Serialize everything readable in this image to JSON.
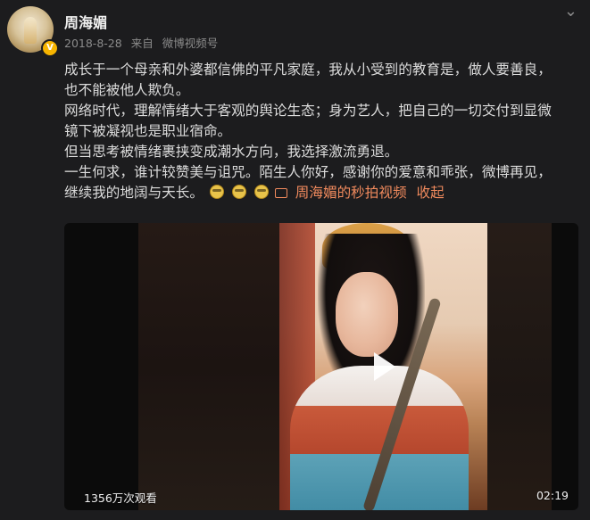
{
  "post": {
    "user": {
      "name": "周海媚",
      "verified_badge": "V"
    },
    "meta": {
      "date": "2018-8-28",
      "source_prefix": "来自",
      "source": "微博视频号"
    },
    "more_icon": "chevron-down-icon",
    "content_lines": [
      "成长于一个母亲和外婆都信佛的平凡家庭，我从小受到的教育是，做人要善良，",
      "也不能被他人欺负。",
      "网络时代，理解情绪大于客观的舆论生态；身为艺人，把自己的一切交付到显微",
      "镜下被凝视也是职业宿命。",
      "但当思考被情绪裹挟变成潮水方向，我选择激流勇退。",
      "一生何求，谁计较赞美与诅咒。陌生人你好，感谢你的爱意和乖张，微博再见，"
    ],
    "last_line_prefix": "继续我的地阔与天长。",
    "video_link_label": "周海媚的秒拍视频",
    "collapse_label": "收起",
    "video": {
      "views": "1356万次观看",
      "duration": "02:19"
    }
  }
}
